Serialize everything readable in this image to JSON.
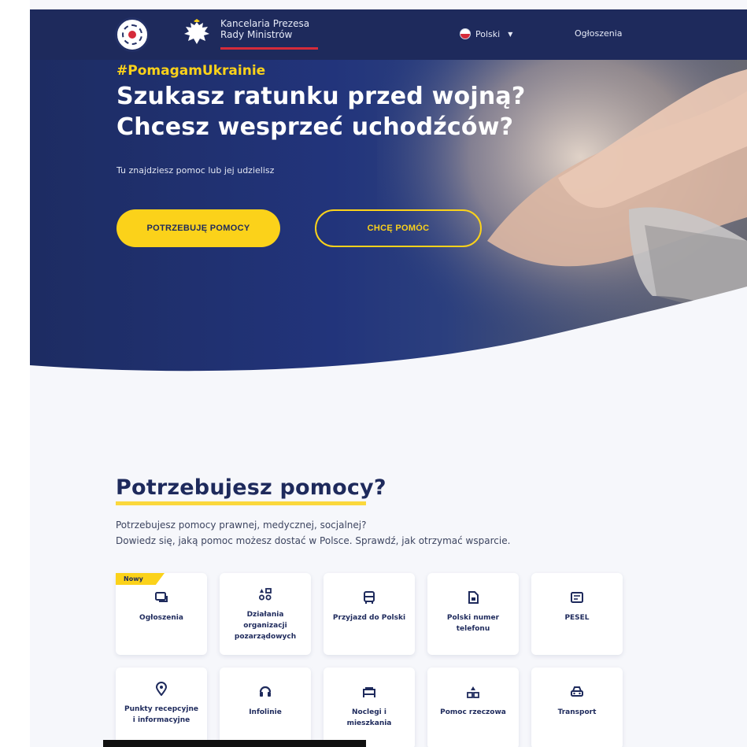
{
  "header": {
    "brand_line1": "Kancelaria Prezesa",
    "brand_line2": "Rady Ministrów",
    "language": "Polski",
    "nav_announcements": "Ogłoszenia"
  },
  "hero": {
    "hashtag": "#PomagamUkrainie",
    "title_line1": "Szukasz ratunku przed wojną?",
    "title_line2": "Chcesz wesprzeć uchodźców?",
    "subtitle": "Tu znajdziesz pomoc lub jej udzielisz",
    "btn_need_help": "POTRZEBUJĘ POMOCY",
    "btn_want_help": "CHCĘ POMÓC"
  },
  "help": {
    "title": "Potrzebujesz pomocy?",
    "desc_line1": "Potrzebujesz pomocy prawnej, medycznej, socjalnej?",
    "desc_line2": "Dowiedz się, jaką pomoc możesz dostać w Polsce. Sprawdź, jak otrzymać wsparcie.",
    "badge_new": "Nowy",
    "cards": [
      {
        "label": "Ogłoszenia",
        "icon": "chat-icon"
      },
      {
        "label": "Działania organizacji pozarządowych",
        "icon": "grid-shapes-icon"
      },
      {
        "label": "Przyjazd do Polski",
        "icon": "bus-icon"
      },
      {
        "label": "Polski numer telefonu",
        "icon": "sim-card-icon"
      },
      {
        "label": "PESEL",
        "icon": "id-card-icon"
      },
      {
        "label": "Punkty recepcyjne i informacyjne",
        "icon": "location-pin-icon"
      },
      {
        "label": "Infolinie",
        "icon": "phone-icon"
      },
      {
        "label": "Noclegi i mieszkania",
        "icon": "bed-icon"
      },
      {
        "label": "Pomoc rzeczowa",
        "icon": "boxes-icon"
      },
      {
        "label": "Transport",
        "icon": "car-icon"
      }
    ]
  },
  "colors": {
    "navy": "#1e2a5c",
    "yellow": "#fbd21a",
    "red": "#d52b3a",
    "background": "#f6f7fb"
  }
}
